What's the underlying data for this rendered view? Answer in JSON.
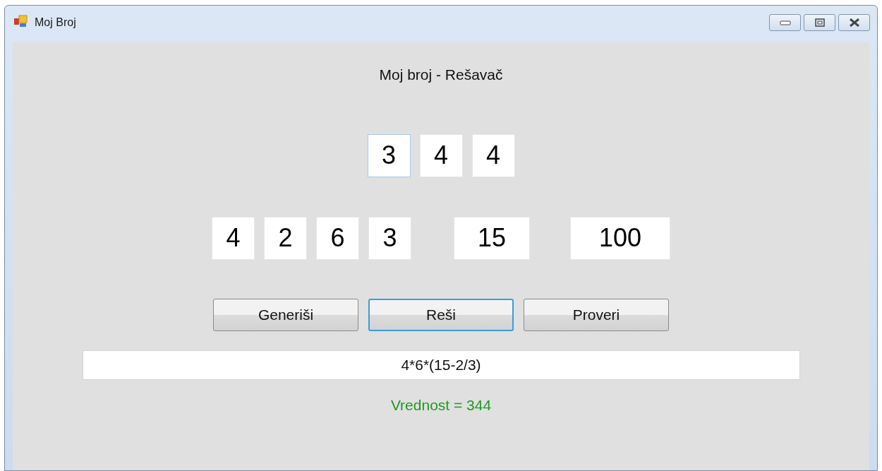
{
  "window": {
    "title": "Moj Broj"
  },
  "heading": "Moj broj - Rešavač",
  "target_digits": [
    {
      "value": "3",
      "focused": true
    },
    {
      "value": "4",
      "focused": false
    },
    {
      "value": "4",
      "focused": false
    }
  ],
  "numbers": [
    {
      "value": "4",
      "kind": "small"
    },
    {
      "value": "2",
      "kind": "small"
    },
    {
      "value": "6",
      "kind": "small"
    },
    {
      "value": "3",
      "kind": "small"
    },
    {
      "value": "15",
      "kind": "medium"
    },
    {
      "value": "100",
      "kind": "large"
    }
  ],
  "buttons": [
    {
      "label": "Generiši",
      "focused": false
    },
    {
      "label": "Reši",
      "focused": true
    },
    {
      "label": "Proveri",
      "focused": false
    }
  ],
  "expression": "4*6*(15-2/3)",
  "result": "Vrednost = 344"
}
